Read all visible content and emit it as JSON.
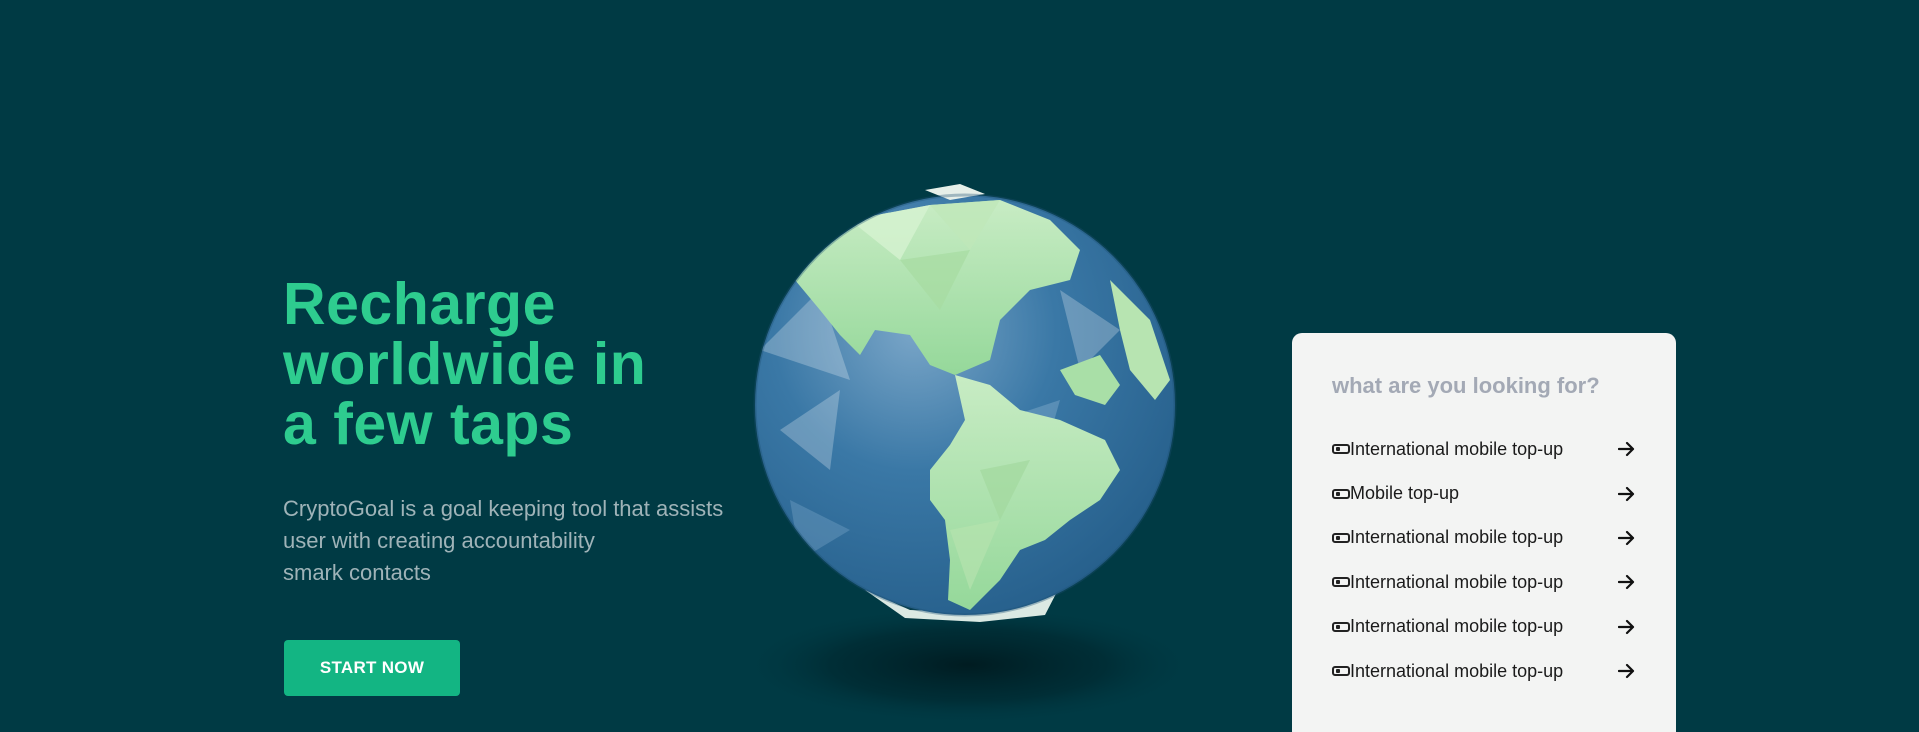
{
  "hero": {
    "title_lines": [
      "Recharge",
      "worldwide in",
      "a few taps"
    ],
    "description_lines": [
      "CryptoGoal is a goal keeping tool that assists",
      "user with creating accountability",
      "smark contacts"
    ],
    "cta_label": "START NOW"
  },
  "search_card": {
    "title": "what are you looking for?",
    "options": [
      {
        "label": "International mobile top-up",
        "icon": "sim-card-icon"
      },
      {
        "label": "Mobile top-up",
        "icon": "sim-card-icon"
      },
      {
        "label": "International mobile top-up",
        "icon": "sim-card-icon"
      },
      {
        "label": "International mobile top-up",
        "icon": "sim-card-icon"
      },
      {
        "label": "International mobile top-up",
        "icon": "sim-card-icon"
      },
      {
        "label": "International mobile top-up",
        "icon": "sim-card-icon"
      }
    ]
  },
  "colors": {
    "background": "#003a44",
    "accent": "#2ecc8f",
    "button": "#13b583",
    "card": "#f3f4f3"
  }
}
